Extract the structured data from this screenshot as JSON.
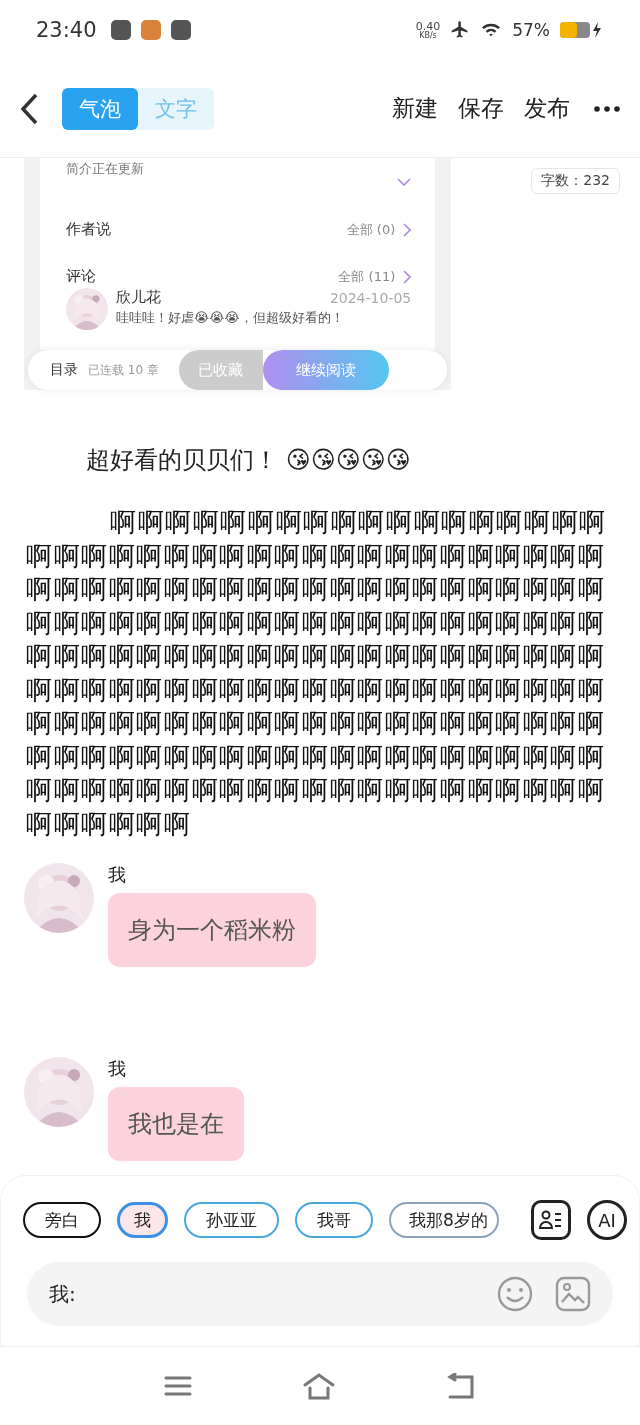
{
  "status_bar": {
    "time": "23:40",
    "speed_value": "0.40",
    "speed_unit": "KB/s",
    "battery": "57%"
  },
  "toolbar": {
    "tabs": [
      {
        "label": "气泡",
        "selected": true
      },
      {
        "label": "文字",
        "selected": false
      }
    ],
    "actions": [
      "新建",
      "保存",
      "发布"
    ]
  },
  "preview": {
    "intro": "简介正在更新",
    "author_label": "作者说",
    "author_count": "全部 (0)",
    "comments_label": "评论",
    "comments_count": "全部 (11)",
    "comment": {
      "user": "欣儿花",
      "date": "2024-10-05",
      "text": "哇哇哇！好虐😭😭😭，但超级好看的！"
    },
    "bottom": {
      "toc": "目录",
      "chapters": "已连载 10 章",
      "collected": "已收藏",
      "continue": "继续阅读"
    }
  },
  "word_count": "字数：232",
  "heading": "超好看的贝贝们！ 😘😘😘😘😘",
  "paragraph": "啊啊啊啊啊啊啊啊啊啊啊啊啊啊啊啊啊啊啊啊啊啊啊啊啊啊啊啊啊啊啊啊啊啊啊啊啊啊啊啊啊啊啊啊啊啊啊啊啊啊啊啊啊啊啊啊啊啊啊啊啊啊啊啊啊啊啊啊啊啊啊啊啊啊啊啊啊啊啊啊啊啊啊啊啊啊啊啊啊啊啊啊啊啊啊啊啊啊啊啊啊啊啊啊啊啊啊啊啊啊啊啊啊啊啊啊啊啊啊啊啊啊啊啊啊啊啊啊啊啊啊啊啊啊啊啊啊啊啊啊啊啊啊啊啊啊啊啊啊啊啊啊啊啊啊啊啊啊啊啊啊啊啊啊啊啊啊啊啊啊啊啊啊啊啊啊啊啊啊啊啊啊啊啊啊啊啊啊啊啊啊啊",
  "messages": [
    {
      "name": "我",
      "text": "身为一个稻米粉"
    },
    {
      "name": "我",
      "text": "我也是在"
    }
  ],
  "characters": [
    {
      "label": "旁白",
      "selected": false,
      "color": "#111111"
    },
    {
      "label": "我",
      "selected": true,
      "color": "#3d8ee6"
    },
    {
      "label": "孙亚亚",
      "selected": false,
      "color": "#4aa8e0"
    },
    {
      "label": "我哥",
      "selected": false,
      "color": "#4aa8e0"
    },
    {
      "label": "我那8岁的",
      "selected": false,
      "color": "#8fa3b8"
    }
  ],
  "input": {
    "placeholder": "我:"
  },
  "ai_button": "AI"
}
